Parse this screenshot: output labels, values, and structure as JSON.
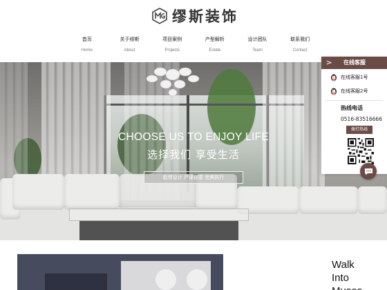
{
  "brand": {
    "name": "缪斯装饰"
  },
  "nav": [
    {
      "cn": "首页",
      "en": "Home"
    },
    {
      "cn": "关于缪斯",
      "en": "About"
    },
    {
      "cn": "项目案例",
      "en": "Projects"
    },
    {
      "cn": "产型解析",
      "en": "Estate"
    },
    {
      "cn": "设计团队",
      "en": "Team"
    },
    {
      "cn": "联系我们",
      "en": "Contact"
    }
  ],
  "hero": {
    "title": "CHOOSE US TO ENJOY LIFE",
    "subtitle": "选择我们 享受生活",
    "button": "彪悍设计 严谨创意 完美执行"
  },
  "service_panel": {
    "collapse_glyph": ">",
    "title": "在线客服",
    "agents": [
      "在线客服1号",
      "在线客服2号"
    ],
    "hotline_label": "热线电话",
    "hotline_number": "0516-83516666",
    "hotline_button": "拨打热线"
  },
  "about": {
    "heading": [
      "Walk",
      "Into",
      "Muses"
    ]
  },
  "colors": {
    "accent": "#6b4b46",
    "text": "#333333"
  }
}
